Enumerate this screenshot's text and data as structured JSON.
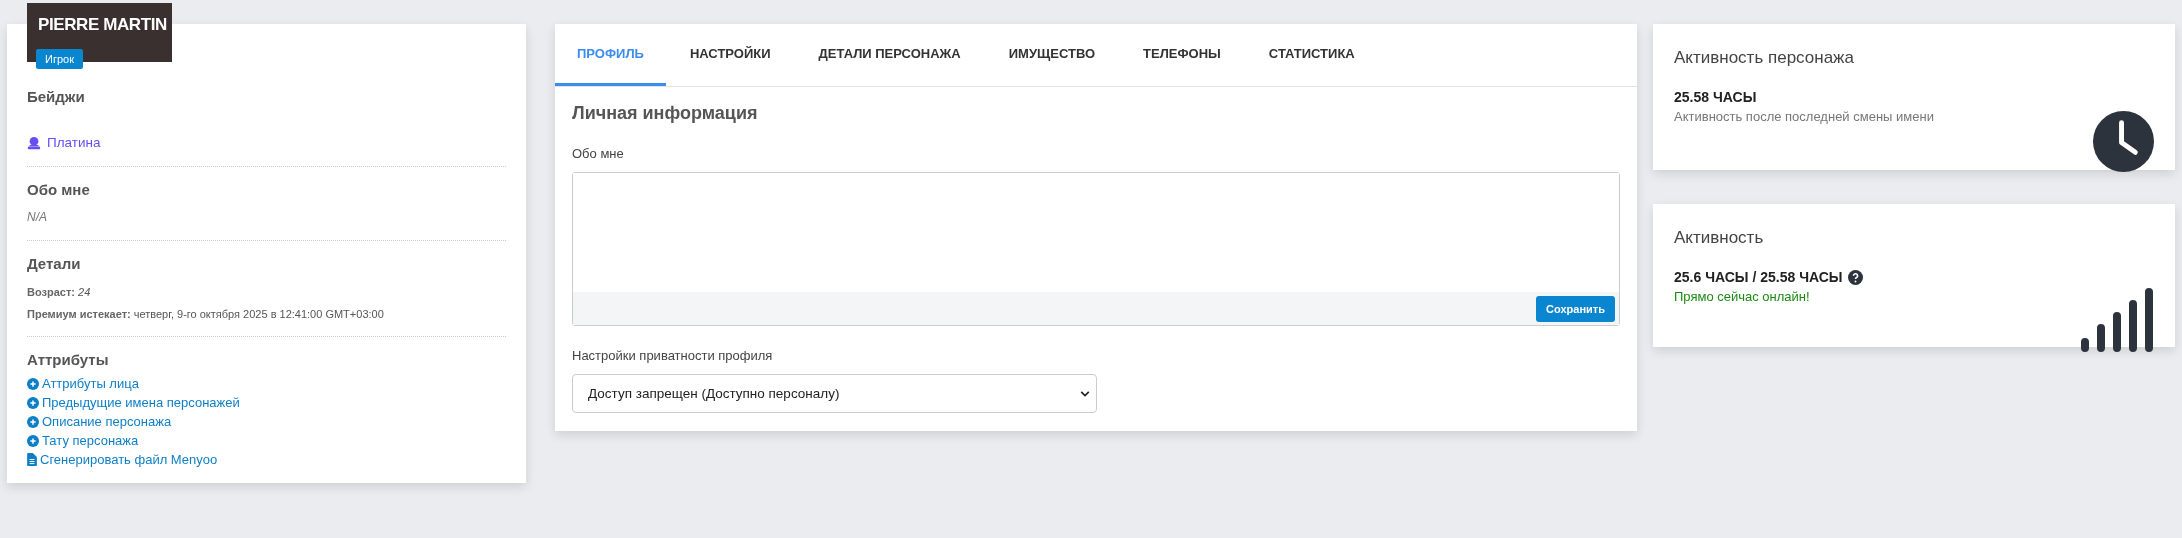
{
  "profile": {
    "name": "PIERRE MARTIN",
    "role": "Игрок"
  },
  "badges": {
    "title": "Бейджи",
    "items": [
      {
        "label": "Платина"
      }
    ]
  },
  "about": {
    "title": "Обо мне",
    "text": "N/A"
  },
  "details": {
    "title": "Детали",
    "lines": [
      "**Возраст:** *24*",
      "**Премиум истекает:** четверг, 9-го октября 2025 в 12:41:00 GMT+03:00"
    ]
  },
  "attributes": {
    "title": "Аттрибуты",
    "links": [
      {
        "kind": "plus",
        "label": "Аттрибуты лица"
      },
      {
        "kind": "plus",
        "label": "Предыдущие имена персонажей"
      },
      {
        "kind": "plus",
        "label": "Описание персонажа"
      },
      {
        "kind": "plus",
        "label": "Тату персонажа"
      },
      {
        "kind": "file",
        "label": "Сгенерировать файл Menyoo"
      }
    ]
  },
  "tabs": [
    {
      "label": "ПРОФИЛЬ",
      "selected": true
    },
    {
      "label": "НАСТРОЙКИ",
      "selected": false
    },
    {
      "label": "ДЕТАЛИ ПЕРСОНАЖА",
      "selected": false
    },
    {
      "label": "ИМУЩЕСТВО",
      "selected": false
    },
    {
      "label": "ТЕЛЕФОНЫ",
      "selected": false
    },
    {
      "label": "СТАТИСТИКА",
      "selected": false
    }
  ],
  "personal": {
    "title": "Личная информация",
    "about_label": "Обо мне",
    "save_button": "Сохранить",
    "privacy_label": "Настройки приватности профиля",
    "privacy_value": "Доступ запрещен (Доступно персоналу)"
  },
  "character_activity": {
    "title": "Активность персонажа",
    "value": "25.58 ЧАСЫ",
    "caption": "Активность после последней смены имени"
  },
  "activity": {
    "title": "Активность",
    "value": "25.6 ЧАСЫ / 25.58 ЧАСЫ",
    "status": "Прямо сейчас онлайн!"
  }
}
